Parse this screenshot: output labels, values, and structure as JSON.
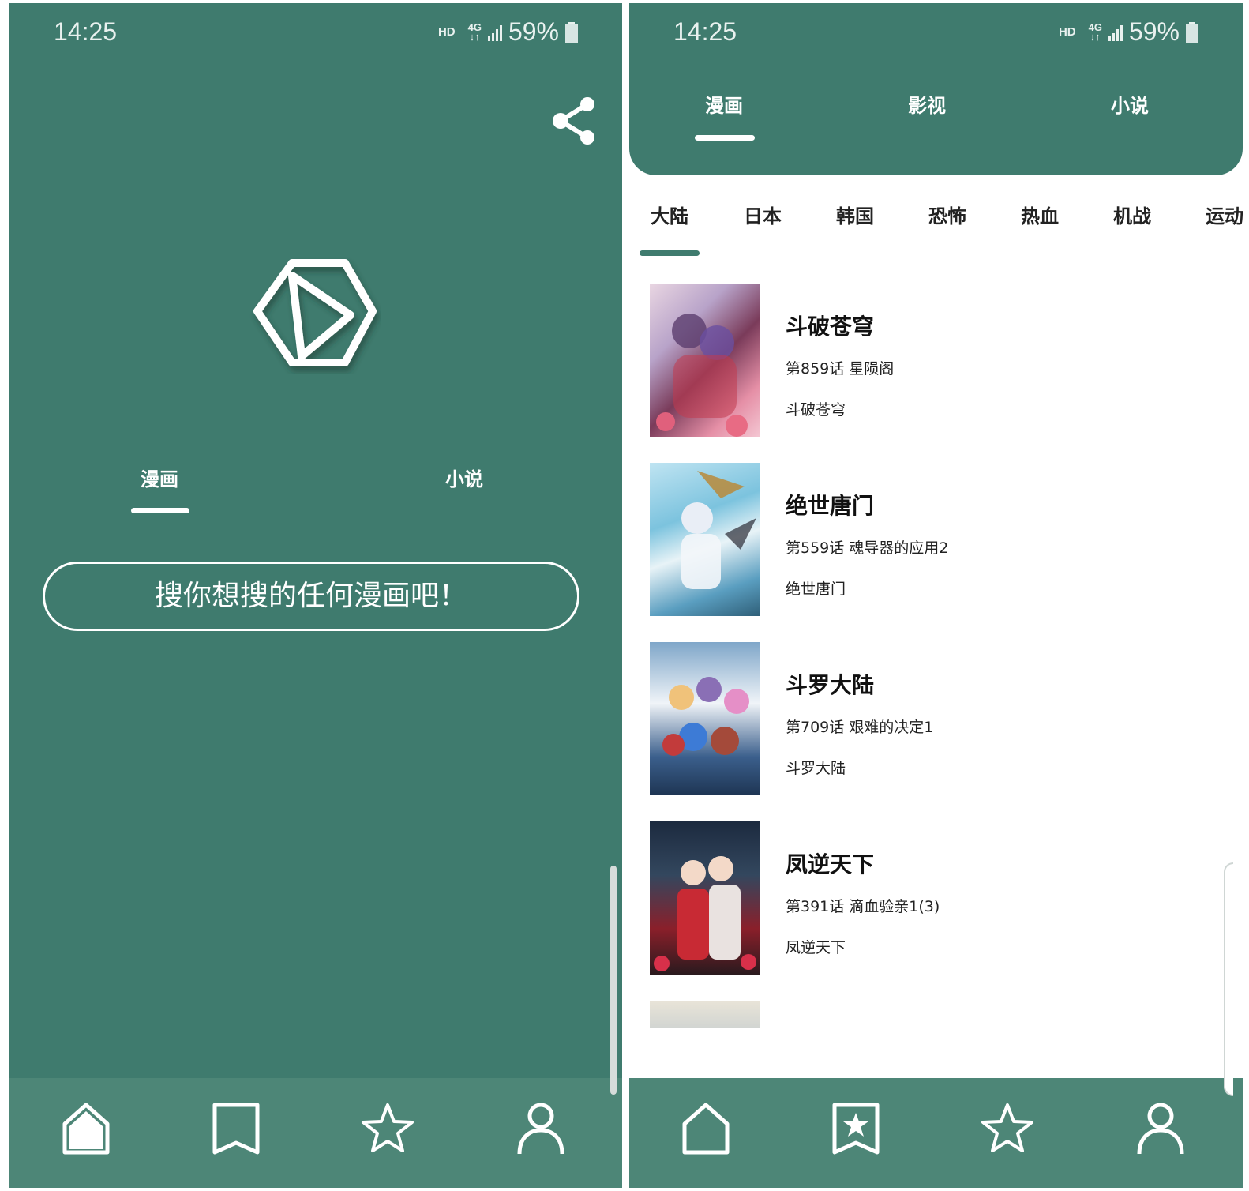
{
  "left": {
    "status": {
      "time": "14:25",
      "hd": "HD",
      "network": "4G",
      "battery": "59%"
    },
    "tabs": [
      {
        "label": "漫画"
      },
      {
        "label": "小说"
      }
    ],
    "search_placeholder": "搜你想搜的任何漫画吧！",
    "nav": [
      {
        "icon": "home-icon",
        "active": true
      },
      {
        "icon": "bookmark-icon"
      },
      {
        "icon": "star-icon"
      },
      {
        "icon": "user-icon"
      }
    ]
  },
  "right": {
    "status": {
      "time": "14:25",
      "hd": "HD",
      "network": "4G",
      "battery": "59%"
    },
    "top_tabs": [
      {
        "label": "漫画"
      },
      {
        "label": "影视"
      },
      {
        "label": "小说"
      }
    ],
    "categories": [
      "大陆",
      "日本",
      "韩国",
      "恐怖",
      "热血",
      "机战",
      "运动"
    ],
    "comics": [
      {
        "title": "斗破苍穹",
        "chapter": "第859话 星陨阁",
        "author": "斗破苍穹"
      },
      {
        "title": "绝世唐门",
        "chapter": "第559话 魂导器的应用2",
        "author": "绝世唐门"
      },
      {
        "title": "斗罗大陆",
        "chapter": "第709话 艰难的决定1",
        "author": "斗罗大陆"
      },
      {
        "title": "凤逆天下",
        "chapter": "第391话 滴血验亲1(3)",
        "author": "凤逆天下"
      }
    ],
    "nav": [
      {
        "icon": "home-icon"
      },
      {
        "icon": "bookmark-star-icon",
        "active": true
      },
      {
        "icon": "star-icon"
      },
      {
        "icon": "user-icon"
      }
    ]
  },
  "colors": {
    "primary": "#3f7b6e",
    "nav_bg": "#4d8677",
    "text": "#222222"
  }
}
